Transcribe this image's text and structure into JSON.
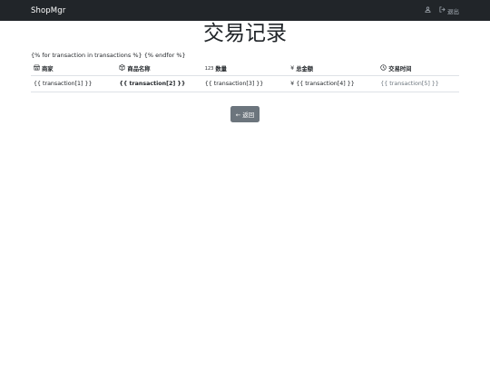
{
  "navbar": {
    "brand": "ShopMgr",
    "logout_label": "退出"
  },
  "page": {
    "title": "交易记录",
    "template_line": "{% for transaction in transactions %} {% endfor %}"
  },
  "table": {
    "headers": [
      "商家",
      "商品名称",
      "数量",
      "总金额",
      "交易时间"
    ],
    "header_icons": [
      "shop-icon",
      "box-icon",
      "numbers-icon",
      "yen-icon",
      "clock-icon"
    ],
    "rows": [
      [
        "{{ transaction[1] }}",
        "{{ transaction[2] }}",
        "{{ transaction[3] }}",
        "{{ transaction[4] }}",
        "{{ transaction[5] }}"
      ]
    ]
  },
  "actions": {
    "back_label": "← 返回"
  },
  "colors": {
    "navbar_bg": "#212529",
    "button_bg": "#6c757d",
    "muted_text": "#6c757d"
  }
}
